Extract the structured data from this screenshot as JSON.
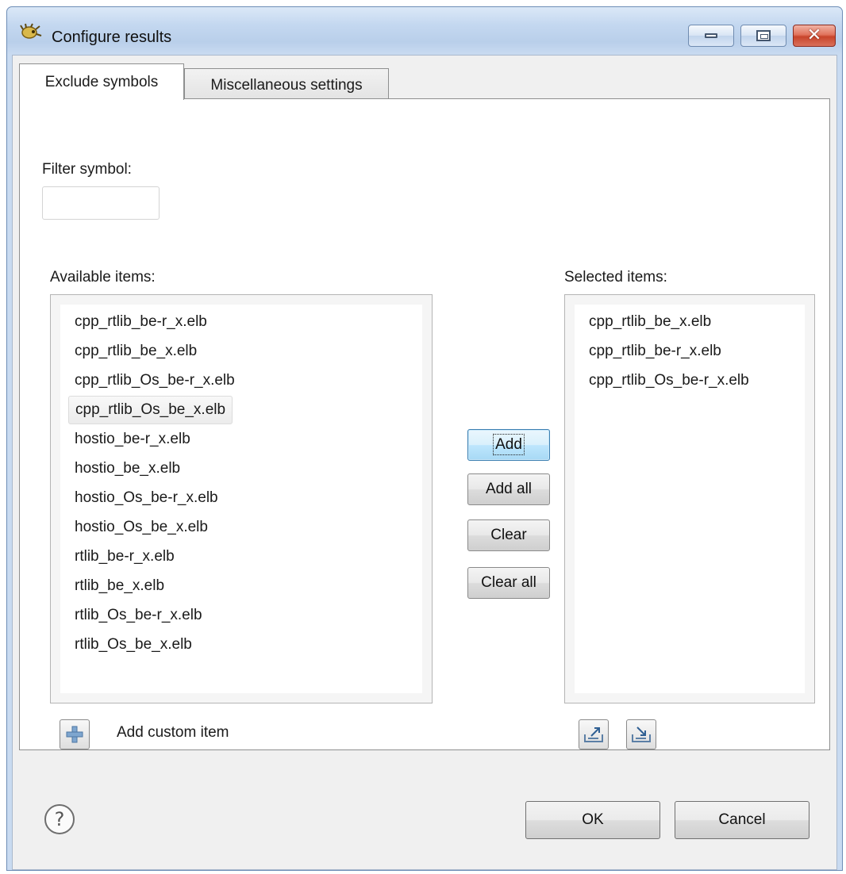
{
  "window": {
    "title": "Configure results"
  },
  "tabs": [
    {
      "label": "Exclude symbols",
      "active": true
    },
    {
      "label": "Miscellaneous settings",
      "active": false
    }
  ],
  "filter": {
    "label": "Filter symbol:",
    "value": ""
  },
  "available": {
    "label": "Available items:",
    "items": [
      "cpp_rtlib_be-r_x.elb",
      "cpp_rtlib_be_x.elb",
      "cpp_rtlib_Os_be-r_x.elb",
      "cpp_rtlib_Os_be_x.elb",
      "hostio_be-r_x.elb",
      "hostio_be_x.elb",
      "hostio_Os_be-r_x.elb",
      "hostio_Os_be_x.elb",
      "rtlib_be-r_x.elb",
      "rtlib_be_x.elb",
      "rtlib_Os_be-r_x.elb",
      "rtlib_Os_be_x.elb"
    ]
  },
  "selected": {
    "label": "Selected items:",
    "items": [
      "cpp_rtlib_be_x.elb",
      "cpp_rtlib_be-r_x.elb",
      "cpp_rtlib_Os_be-r_x.elb"
    ]
  },
  "transfer": {
    "add": "Add",
    "add_all": "Add all",
    "clear": "Clear",
    "clear_all": "Clear all"
  },
  "custom": {
    "label": "Add custom item"
  },
  "footer": {
    "ok": "OK",
    "cancel": "Cancel"
  },
  "icons": {
    "app": "app-icon",
    "minimize": "minimize-icon",
    "maximize": "maximize-icon",
    "close": "close-icon",
    "plus": "plus-icon",
    "export": "export-icon",
    "import": "import-icon",
    "help": "help-icon"
  },
  "colors": {
    "title_bar": "#c4d8f0",
    "close_button": "#c8452b",
    "focus_button": "#bee6fd"
  }
}
